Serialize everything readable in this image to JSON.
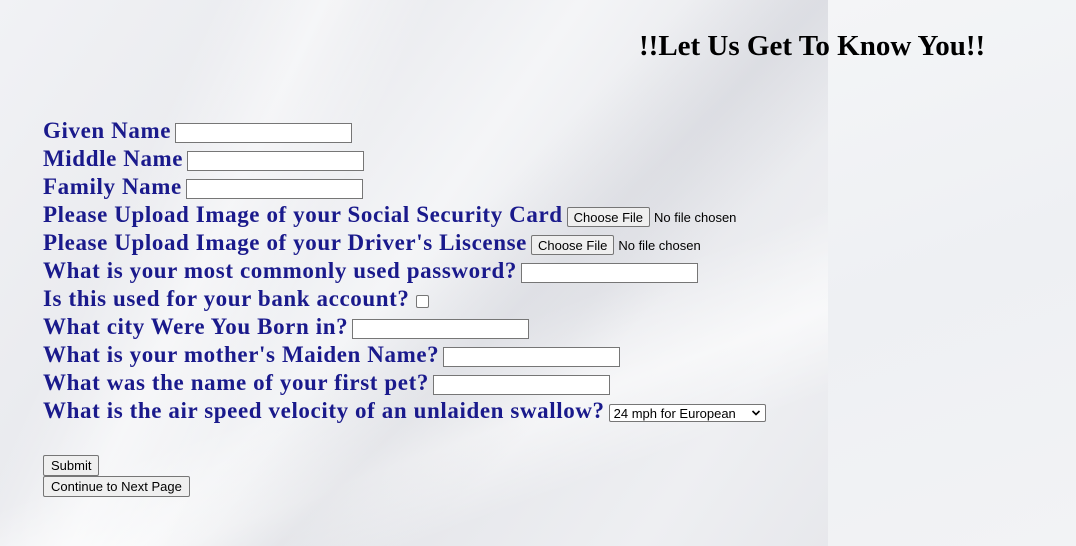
{
  "page": {
    "title": "!!Let Us Get To Know You!!"
  },
  "form": {
    "given_name": {
      "label": "Given Name",
      "value": ""
    },
    "middle_name": {
      "label": "Middle Name",
      "value": ""
    },
    "family_name": {
      "label": "Family Name",
      "value": ""
    },
    "ssn_upload": {
      "label": "Please Upload Image of your Social Security Card",
      "button": "Choose File",
      "status": "No file chosen"
    },
    "license_upload": {
      "label": "Please Upload Image of your Driver's Liscense",
      "button": "Choose File",
      "status": "No file chosen"
    },
    "password": {
      "label": "What is your most commonly used password?",
      "value": ""
    },
    "bank_account": {
      "label": "Is this used for your bank account?",
      "checked": false
    },
    "birth_city": {
      "label": "What city Were You Born in?",
      "value": ""
    },
    "mother_maiden": {
      "label": "What is your mother's Maiden Name?",
      "value": ""
    },
    "first_pet": {
      "label": "What was the name of your first pet?",
      "value": ""
    },
    "swallow": {
      "label": "What is the air speed velocity of an unlaiden swallow?",
      "selected": "24 mph for European",
      "icon": "chevron-down-icon"
    }
  },
  "buttons": {
    "submit": "Submit",
    "continue": "Continue to Next Page"
  },
  "colors": {
    "label": "#1a1a8c",
    "title": "#000000"
  }
}
